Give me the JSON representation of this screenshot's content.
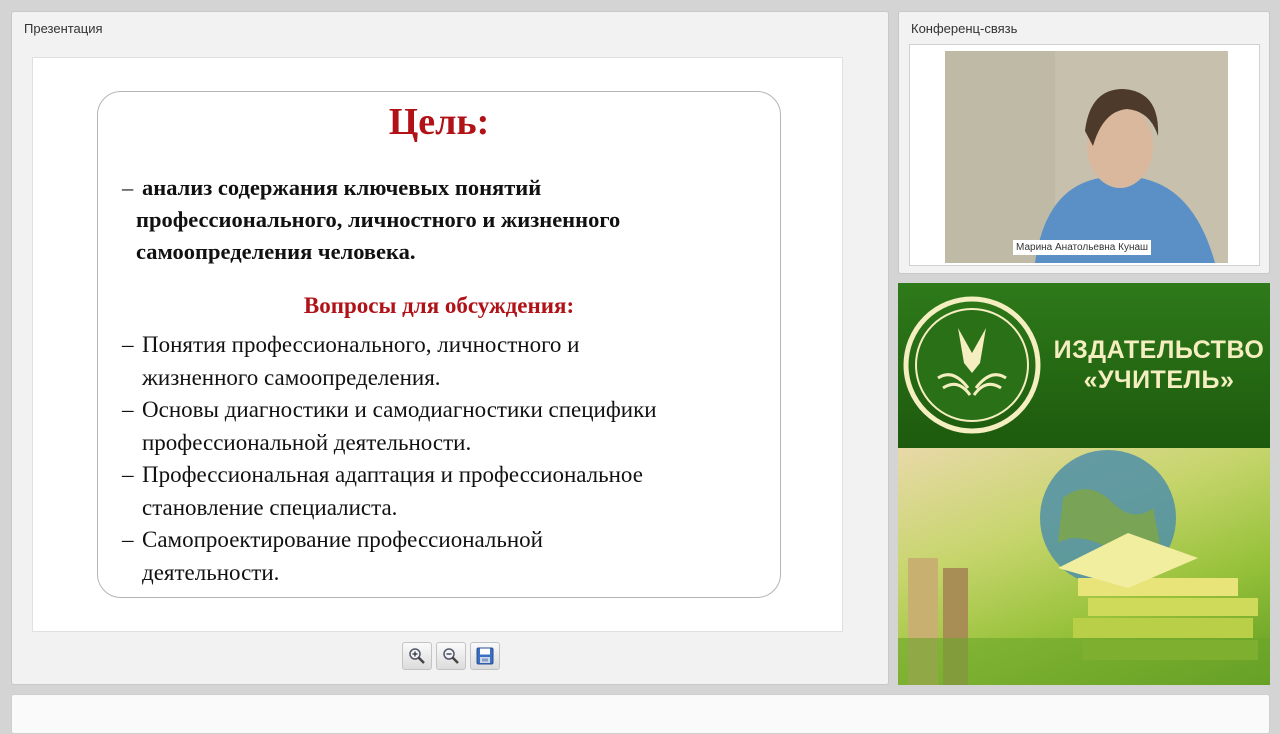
{
  "presentation": {
    "title": "Презентация",
    "slide": {
      "heading": "Цель:",
      "goal_dash": "–",
      "goal_lines": [
        "анализ содержания ключевых понятий",
        "профессионального,  личностного и жизненного",
        "самоопределения человека."
      ],
      "questions_heading": "Вопросы для обсуждения:",
      "question_dash": "–",
      "questions": [
        {
          "line1": "Понятия профессионального, личностного и",
          "line2": "жизненного самоопределения."
        },
        {
          "line1": "Основы диагностики и самодиагностики специфики",
          "line2": "профессиональной деятельности."
        },
        {
          "line1": "Профессиональная адаптация и профессиональное",
          "line2": "становление специалиста."
        },
        {
          "line1": "Самопроектирование профессиональной",
          "line2": "деятельности."
        }
      ]
    },
    "toolbar": {
      "zoom_in_icon": "zoom-in-icon",
      "zoom_out_icon": "zoom-out-icon",
      "save_icon": "floppy-disk-icon"
    }
  },
  "conference": {
    "title": "Конференц-связь",
    "speaker_name": "Марина Анатольевна Кунаш"
  },
  "ad": {
    "line1": "ИЗДАТЕЛЬСТВО",
    "line2": "«УЧИТЕЛЬ»",
    "colors": {
      "green": "#2e7a1a",
      "text": "#f5eec0"
    }
  },
  "colors": {
    "accent_red": "#b01217"
  }
}
